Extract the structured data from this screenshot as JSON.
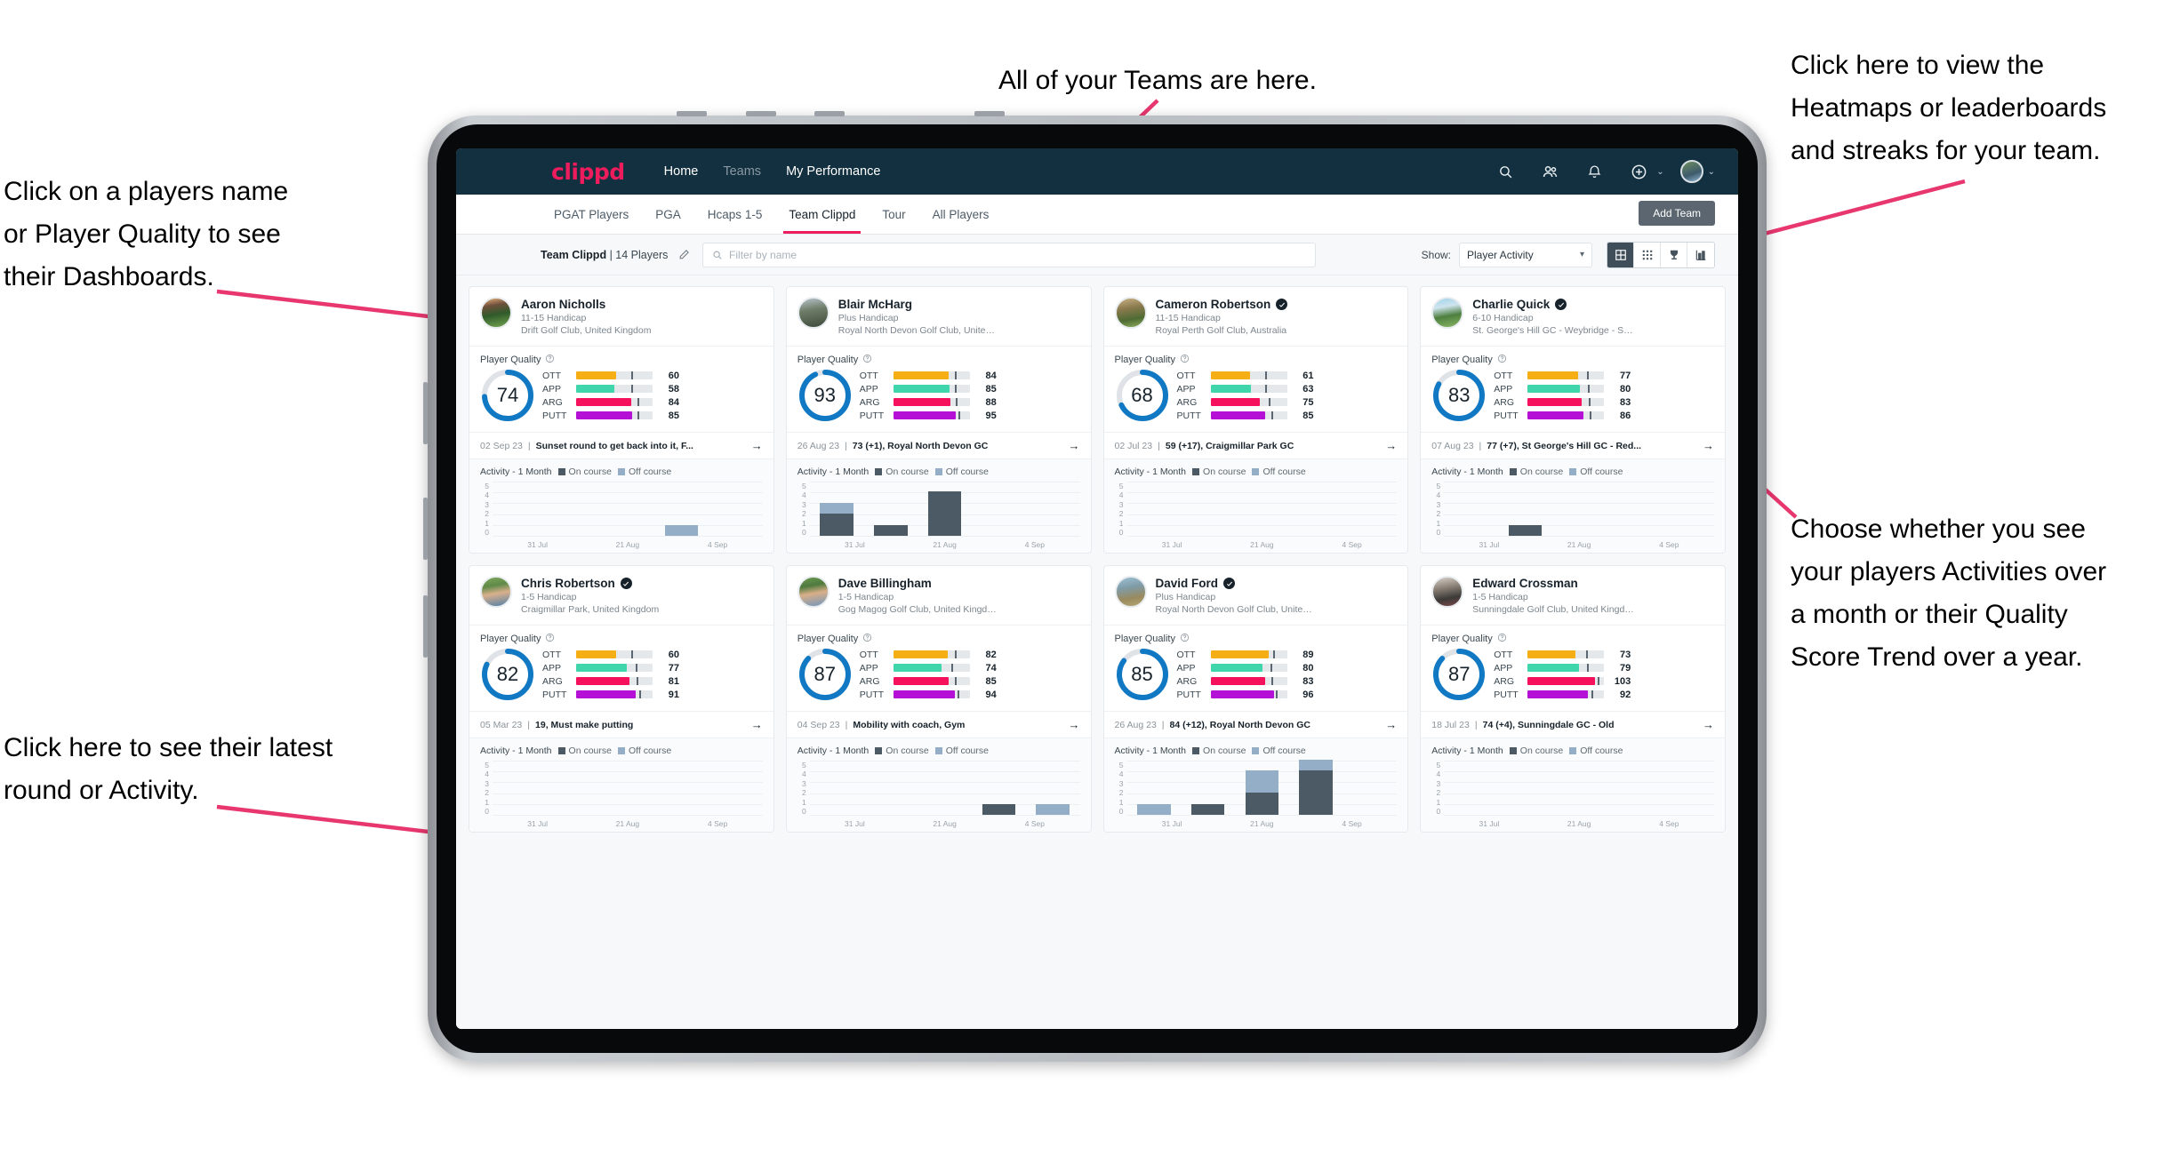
{
  "annotations": [
    {
      "id": "teams",
      "text": "All of your Teams are here."
    },
    {
      "id": "heatmaps",
      "text": "Click here to view the\nHeatmaps or leaderboards\nand streaks for your team."
    },
    {
      "id": "playername",
      "text": "Click on a players name\nor Player Quality to see\ntheir Dashboards."
    },
    {
      "id": "activity-choice",
      "text": "Choose whether you see\nyour players Activities over\na month or their Quality\nScore Trend over a year."
    },
    {
      "id": "latest-round",
      "text": "Click here to see their latest\nround or Activity."
    }
  ],
  "topnav": {
    "logo": "clippd",
    "links": [
      {
        "label": "Home",
        "state": "active"
      },
      {
        "label": "Teams",
        "state": "dim"
      },
      {
        "label": "My Performance",
        "state": "active"
      }
    ],
    "icons": [
      "search-icon",
      "people-icon",
      "bell-icon",
      "plus-circle-icon"
    ],
    "caret": "⌄"
  },
  "tabs": [
    {
      "label": "PGAT Players",
      "active": false
    },
    {
      "label": "PGA",
      "active": false
    },
    {
      "label": "Hcaps 1-5",
      "active": false
    },
    {
      "label": "Team Clippd",
      "active": true
    },
    {
      "label": "Tour",
      "active": false
    },
    {
      "label": "All Players",
      "active": false
    }
  ],
  "add_team_label": "Add Team",
  "toolbar": {
    "team_name": "Team Clippd",
    "team_count": "| 14 Players",
    "search_placeholder": "Filter by name",
    "search_value": "",
    "show_label": "Show:",
    "show_value": "Player Activity",
    "show_options": [
      "Player Activity",
      "Quality Score Trend"
    ],
    "views": [
      {
        "name": "card-view-icon",
        "active": true
      },
      {
        "name": "grid-view-icon",
        "active": false
      },
      {
        "name": "trophy-view-icon",
        "active": false
      },
      {
        "name": "leaderboard-view-icon",
        "active": false
      }
    ]
  },
  "card_labels": {
    "player_quality": "Player Quality",
    "activity": "Activity - 1 Month",
    "on_course": "On course",
    "off_course": "Off course",
    "arrow": "→"
  },
  "metric_colors": {
    "OTT": "#f5ae13",
    "APP": "#3fd6ac",
    "ARG": "#f5115c",
    "PUTT": "#b510d6",
    "ring": "#1179c4",
    "ring_track": "#dfe3e7",
    "on_course": "#4c5a66",
    "off_course": "#93aec6"
  },
  "chart_data": {
    "type": "bar",
    "title": "Activity - 1 Month",
    "ylabel": "",
    "xlabel": "",
    "ylim": [
      0,
      5
    ],
    "yticks": [
      5,
      4,
      3,
      2,
      1,
      0
    ],
    "categories": [
      "31 Jul",
      "21 Aug",
      "4 Sep"
    ],
    "legend": [
      "On course",
      "Off course"
    ],
    "legend_position": "top"
  },
  "players": [
    {
      "name": "Aaron Nicholls",
      "verified": false,
      "handicap": "11-15 Handicap",
      "club": "Drift Golf Club, United Kingdom",
      "avatar": "linear-gradient(170deg,#e8b27a 0%,#6f4f3c 26%,#2f5a2a 55%,#74a551 100%)",
      "quality": 74,
      "metrics": [
        {
          "label": "OTT",
          "value": 60,
          "fill_pct": 52,
          "tick_pct": 72
        },
        {
          "label": "APP",
          "value": 58,
          "fill_pct": 50,
          "tick_pct": 72
        },
        {
          "label": "ARG",
          "value": 84,
          "fill_pct": 72,
          "tick_pct": 80
        },
        {
          "label": "PUTT",
          "value": 85,
          "fill_pct": 73,
          "tick_pct": 80
        }
      ],
      "round_date": "02 Sep 23",
      "round_title": "Sunset round to get back into it, F...",
      "activity": [
        {
          "x": "31 Jul",
          "on": 0,
          "off": 0
        },
        {
          "x": "",
          "on": 0,
          "off": 0
        },
        {
          "x": "21 Aug",
          "on": 0,
          "off": 0
        },
        {
          "x": "",
          "on": 0,
          "off": 1
        },
        {
          "x": "4 Sep",
          "on": 0,
          "off": 0
        }
      ]
    },
    {
      "name": "Blair McHarg",
      "verified": false,
      "handicap": "Plus Handicap",
      "club": "Royal North Devon Golf Club, United Kin...",
      "avatar": "linear-gradient(170deg,#b8c3cc 0%,#6e7d69 40%,#3e4a3a 100%)",
      "quality": 93,
      "metrics": [
        {
          "label": "OTT",
          "value": 84,
          "fill_pct": 72,
          "tick_pct": 80
        },
        {
          "label": "APP",
          "value": 85,
          "fill_pct": 73,
          "tick_pct": 81
        },
        {
          "label": "ARG",
          "value": 88,
          "fill_pct": 75,
          "tick_pct": 82
        },
        {
          "label": "PUTT",
          "value": 95,
          "fill_pct": 82,
          "tick_pct": 85
        }
      ],
      "round_date": "26 Aug 23",
      "round_title": "73 (+1), Royal North Devon GC",
      "activity": [
        {
          "x": "31 Jul",
          "on": 2,
          "off": 1
        },
        {
          "x": "",
          "on": 1,
          "off": 0
        },
        {
          "x": "21 Aug",
          "on": 4,
          "off": 0
        },
        {
          "x": "",
          "on": 0,
          "off": 0
        },
        {
          "x": "4 Sep",
          "on": 0,
          "off": 0
        }
      ]
    },
    {
      "name": "Cameron Robertson",
      "verified": true,
      "handicap": "11-15 Handicap",
      "club": "Royal Perth Golf Club, Australia",
      "avatar": "linear-gradient(170deg,#c9b183 0%,#8a7a4e 35%,#4e6b33 70%,#8fae5e 100%)",
      "quality": 68,
      "metrics": [
        {
          "label": "OTT",
          "value": 61,
          "fill_pct": 52,
          "tick_pct": 72
        },
        {
          "label": "APP",
          "value": 63,
          "fill_pct": 53,
          "tick_pct": 72
        },
        {
          "label": "ARG",
          "value": 75,
          "fill_pct": 64,
          "tick_pct": 76
        },
        {
          "label": "PUTT",
          "value": 85,
          "fill_pct": 72,
          "tick_pct": 80
        }
      ],
      "round_date": "02 Jul 23",
      "round_title": "59 (+17), Craigmillar Park GC",
      "activity": [
        {
          "x": "31 Jul",
          "on": 0,
          "off": 0
        },
        {
          "x": "",
          "on": 0,
          "off": 0
        },
        {
          "x": "21 Aug",
          "on": 0,
          "off": 0
        },
        {
          "x": "",
          "on": 0,
          "off": 0
        },
        {
          "x": "4 Sep",
          "on": 0,
          "off": 0
        }
      ]
    },
    {
      "name": "Charlie Quick",
      "verified": true,
      "handicap": "6-10 Handicap",
      "club": "St. George's Hill GC - Weybridge - Surrey, ...",
      "avatar": "linear-gradient(170deg,#9fd3ea 0%,#cfe4ee 30%,#4e7f3f 60%,#89b763 100%)",
      "quality": 83,
      "metrics": [
        {
          "label": "OTT",
          "value": 77,
          "fill_pct": 66,
          "tick_pct": 78
        },
        {
          "label": "APP",
          "value": 80,
          "fill_pct": 68,
          "tick_pct": 79
        },
        {
          "label": "ARG",
          "value": 83,
          "fill_pct": 71,
          "tick_pct": 80
        },
        {
          "label": "PUTT",
          "value": 86,
          "fill_pct": 73,
          "tick_pct": 81
        }
      ],
      "round_date": "07 Aug 23",
      "round_title": "77 (+7), St George's Hill GC - Red...",
      "activity": [
        {
          "x": "31 Jul",
          "on": 0,
          "off": 0
        },
        {
          "x": "",
          "on": 1,
          "off": 0
        },
        {
          "x": "21 Aug",
          "on": 0,
          "off": 0
        },
        {
          "x": "",
          "on": 0,
          "off": 0
        },
        {
          "x": "4 Sep",
          "on": 0,
          "off": 0
        }
      ]
    },
    {
      "name": "Chris Robertson",
      "verified": true,
      "handicap": "1-5 Handicap",
      "club": "Craigmillar Park, United Kingdom",
      "avatar": "linear-gradient(170deg,#7fa75b 0%,#5f8a48 30%,#d9b08c 55%,#4f7ea8 100%)",
      "quality": 82,
      "metrics": [
        {
          "label": "OTT",
          "value": 60,
          "fill_pct": 52,
          "tick_pct": 72
        },
        {
          "label": "APP",
          "value": 77,
          "fill_pct": 66,
          "tick_pct": 78
        },
        {
          "label": "ARG",
          "value": 81,
          "fill_pct": 70,
          "tick_pct": 79
        },
        {
          "label": "PUTT",
          "value": 91,
          "fill_pct": 78,
          "tick_pct": 83
        }
      ],
      "round_date": "05 Mar 23",
      "round_title": "19, Must make putting",
      "activity": [
        {
          "x": "31 Jul",
          "on": 0,
          "off": 0
        },
        {
          "x": "",
          "on": 0,
          "off": 0
        },
        {
          "x": "21 Aug",
          "on": 0,
          "off": 0
        },
        {
          "x": "",
          "on": 0,
          "off": 0
        },
        {
          "x": "4 Sep",
          "on": 0,
          "off": 0
        }
      ]
    },
    {
      "name": "Dave Billingham",
      "verified": false,
      "handicap": "1-5 Handicap",
      "club": "Gog Magog Golf Club, United Kingdom",
      "avatar": "linear-gradient(170deg,#6f9a53 0%,#4d7a3e 30%,#d9ae88 55%,#6f97bf 100%)",
      "quality": 87,
      "metrics": [
        {
          "label": "OTT",
          "value": 82,
          "fill_pct": 71,
          "tick_pct": 80
        },
        {
          "label": "APP",
          "value": 74,
          "fill_pct": 63,
          "tick_pct": 76
        },
        {
          "label": "ARG",
          "value": 85,
          "fill_pct": 72,
          "tick_pct": 80
        },
        {
          "label": "PUTT",
          "value": 94,
          "fill_pct": 81,
          "tick_pct": 84
        }
      ],
      "round_date": "04 Sep 23",
      "round_title": "Mobility with coach, Gym",
      "activity": [
        {
          "x": "31 Jul",
          "on": 0,
          "off": 0
        },
        {
          "x": "",
          "on": 0,
          "off": 0
        },
        {
          "x": "21 Aug",
          "on": 0,
          "off": 0
        },
        {
          "x": "",
          "on": 1,
          "off": 0
        },
        {
          "x": "4 Sep",
          "on": 0,
          "off": 1
        }
      ]
    },
    {
      "name": "David Ford",
      "verified": true,
      "handicap": "Plus Handicap",
      "club": "Royal North Devon Golf Club, United Kin...",
      "avatar": "linear-gradient(170deg,#9fc0d4 0%,#7f9ca8 35%,#9a8a5e 70%,#b5a775 100%)",
      "quality": 85,
      "metrics": [
        {
          "label": "OTT",
          "value": 89,
          "fill_pct": 76,
          "tick_pct": 82
        },
        {
          "label": "APP",
          "value": 80,
          "fill_pct": 68,
          "tick_pct": 79
        },
        {
          "label": "ARG",
          "value": 83,
          "fill_pct": 71,
          "tick_pct": 80
        },
        {
          "label": "PUTT",
          "value": 96,
          "fill_pct": 83,
          "tick_pct": 85
        }
      ],
      "round_date": "26 Aug 23",
      "round_title": "84 (+12), Royal North Devon GC",
      "activity": [
        {
          "x": "31 Jul",
          "on": 0,
          "off": 1
        },
        {
          "x": "",
          "on": 1,
          "off": 0
        },
        {
          "x": "21 Aug",
          "on": 2,
          "off": 2
        },
        {
          "x": "",
          "on": 4,
          "off": 1
        },
        {
          "x": "4 Sep",
          "on": 0,
          "off": 0
        }
      ]
    },
    {
      "name": "Edward Crossman",
      "verified": false,
      "handicap": "1-5 Handicap",
      "club": "Sunningdale Golf Club, United Kingdom",
      "avatar": "linear-gradient(170deg,#d8d2cb 0%,#8e8379 35%,#3c3a38 70%,#7c4a4a 100%)",
      "quality": 87,
      "metrics": [
        {
          "label": "OTT",
          "value": 73,
          "fill_pct": 62,
          "tick_pct": 76
        },
        {
          "label": "APP",
          "value": 79,
          "fill_pct": 67,
          "tick_pct": 78
        },
        {
          "label": "ARG",
          "value": 103,
          "fill_pct": 88,
          "tick_pct": 92
        },
        {
          "label": "PUTT",
          "value": 92,
          "fill_pct": 79,
          "tick_pct": 83
        }
      ],
      "round_date": "18 Jul 23",
      "round_title": "74 (+4), Sunningdale GC - Old",
      "activity": [
        {
          "x": "31 Jul",
          "on": 0,
          "off": 0
        },
        {
          "x": "",
          "on": 0,
          "off": 0
        },
        {
          "x": "21 Aug",
          "on": 0,
          "off": 0
        },
        {
          "x": "",
          "on": 0,
          "off": 0
        },
        {
          "x": "4 Sep",
          "on": 0,
          "off": 0
        }
      ]
    }
  ]
}
